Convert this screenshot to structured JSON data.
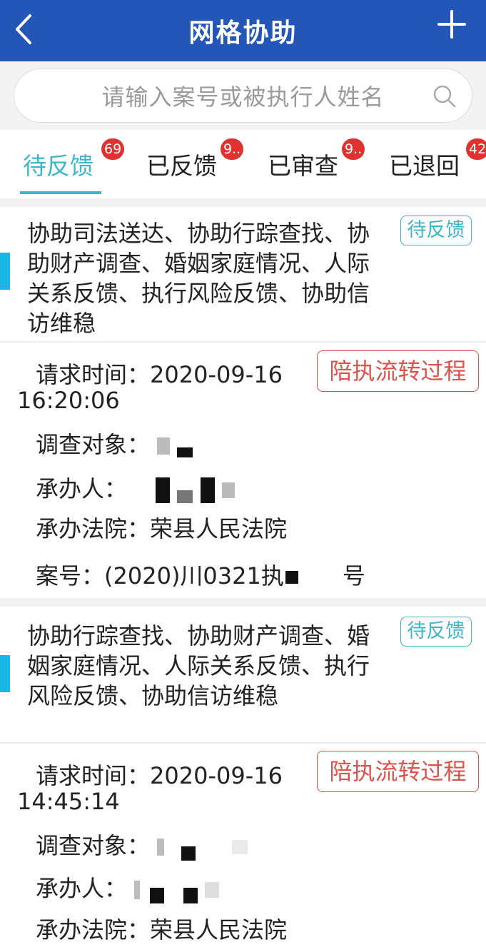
{
  "header": {
    "title": "网格协助"
  },
  "search": {
    "placeholder": "请输入案号或被执行人姓名"
  },
  "tabs": [
    {
      "label": "待反馈",
      "badge": "69",
      "active": true
    },
    {
      "label": "已反馈",
      "badge": "9..",
      "active": false
    },
    {
      "label": "已审查",
      "badge": "9..",
      "active": false
    },
    {
      "label": "已退回",
      "badge": "42",
      "active": false
    }
  ],
  "cards": [
    {
      "title": "协助司法送达、协助行踪查找、协助财产调查、婚姻家庭情况、人际关系反馈、执行风险反馈、协助信访维稳",
      "status": "待反馈",
      "flow_button": "陪执流转过程",
      "request_time_label": "请求时间：",
      "request_date": "2020-09-16",
      "request_clock": "16:20:06",
      "subject_label": "调查对象：",
      "handler_label": "承办人：",
      "court_label": "承办法院：",
      "court": "荣县人民法院",
      "case_label": "案号：",
      "case_prefix": "(2020)川0321执",
      "case_suffix": "号"
    },
    {
      "title": "协助行踪查找、协助财产调查、婚姻家庭情况、人际关系反馈、执行风险反馈、协助信访维稳",
      "status": "待反馈",
      "flow_button": "陪执流转过程",
      "request_time_label": "请求时间：",
      "request_date": "2020-09-16",
      "request_clock": "14:45:14",
      "subject_label": "调查对象：",
      "handler_label": "承办人：",
      "court_label": "承办法院：",
      "court": "荣县人民法院"
    }
  ],
  "colors": {
    "header_bg": "#2356b6",
    "accent": "#3fb6c6",
    "badge": "#e03030",
    "flow": "#d9544f",
    "bar": "#19b7e6"
  }
}
